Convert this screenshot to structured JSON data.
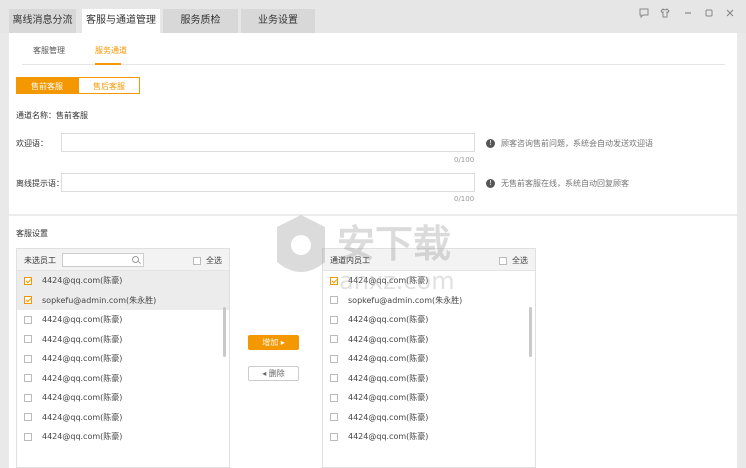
{
  "tabs": [
    {
      "label": "离线消息分流"
    },
    {
      "label": "客服与通道管理"
    },
    {
      "label": "服务质检"
    },
    {
      "label": "业务设置"
    }
  ],
  "subtabs": [
    {
      "label": "客服管理"
    },
    {
      "label": "服务通道"
    }
  ],
  "segments": [
    {
      "label": "售前客服"
    },
    {
      "label": "售后客服"
    }
  ],
  "channel_name": "通道名称：售前客服",
  "welcome": {
    "label": "欢迎语：",
    "value": "",
    "counter": "0/100",
    "hint": "顾客咨询售前问题，系统会自动发送欢迎语"
  },
  "offline": {
    "label": "离线提示语：",
    "value": "",
    "counter": "0/100",
    "hint": "无售前客服在线，系统自动回复顾客"
  },
  "staff_settings_title": "客服设置",
  "left_list": {
    "title": "未选员工",
    "search_placeholder": "",
    "select_all": "全选",
    "rows": [
      {
        "text": "4424@qq.com(陈豪)",
        "checked": true
      },
      {
        "text": "sopkefu@admin.com(朱永胜)",
        "checked": true
      },
      {
        "text": "4424@qq.com(陈豪)",
        "checked": false
      },
      {
        "text": "4424@qq.com(陈豪)",
        "checked": false
      },
      {
        "text": "4424@qq.com(陈豪)",
        "checked": false
      },
      {
        "text": "4424@qq.com(陈豪)",
        "checked": false
      },
      {
        "text": "4424@qq.com(陈豪)",
        "checked": false
      },
      {
        "text": "4424@qq.com(陈豪)",
        "checked": false
      },
      {
        "text": "4424@qq.com(陈豪)",
        "checked": false
      }
    ]
  },
  "right_list": {
    "title": "通道内员工",
    "select_all": "全选",
    "rows": [
      {
        "text": "4424@qq.com(陈豪)",
        "checked": true
      },
      {
        "text": "sopkefu@admin.com(朱永胜)",
        "checked": false
      },
      {
        "text": "4424@qq.com(陈豪)",
        "checked": false
      },
      {
        "text": "4424@qq.com(陈豪)",
        "checked": false
      },
      {
        "text": "4424@qq.com(陈豪)",
        "checked": false
      },
      {
        "text": "4424@qq.com(陈豪)",
        "checked": false
      },
      {
        "text": "4424@qq.com(陈豪)",
        "checked": false
      },
      {
        "text": "4424@qq.com(陈豪)",
        "checked": false
      },
      {
        "text": "4424@qq.com(陈豪)",
        "checked": false
      }
    ]
  },
  "add_button": "增加 ▸",
  "remove_button": "◂ 删除",
  "window_buttons": [
    "comment-icon",
    "shirt-icon",
    "minimize-icon",
    "maximize-icon",
    "close-icon"
  ],
  "watermark": {
    "text": "安下载",
    "sub": "anxz.com"
  },
  "colors": {
    "accent": "#f39800"
  }
}
